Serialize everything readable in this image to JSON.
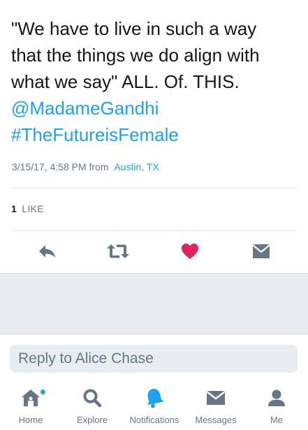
{
  "tweet": {
    "lines": [
      "\"We have to live in such a way",
      "that the things we do align with",
      "what we say\" ALL. Of. THIS."
    ],
    "mention": "@MadameGandhi",
    "hashtag": "#TheFutureisFemale",
    "timestamp": "3/15/17, 4:58 PM from",
    "location": "Austin, TX",
    "like_count": "1",
    "like_label": "LIKE"
  },
  "actions": {
    "reply_icon": "reply-icon",
    "retweet_icon": "retweet-icon",
    "like_icon": "heart-icon",
    "dm_icon": "envelope-icon",
    "like_color": "#e0245e",
    "icon_color": "#657786"
  },
  "reply": {
    "placeholder": "Reply to Alice Chase"
  },
  "tabbar": {
    "items": [
      {
        "label": "Home",
        "icon": "home-icon",
        "active": false,
        "has_dot": true
      },
      {
        "label": "Explore",
        "icon": "search-icon",
        "active": false
      },
      {
        "label": "Notifications",
        "icon": "bell-icon",
        "active": true
      },
      {
        "label": "Messages",
        "icon": "envelope-icon",
        "active": false
      },
      {
        "label": "Me",
        "icon": "person-icon",
        "active": false
      }
    ]
  },
  "colors": {
    "accent": "#1da1f2",
    "muted": "#657786",
    "text": "#14171a",
    "heart": "#e0245e"
  }
}
